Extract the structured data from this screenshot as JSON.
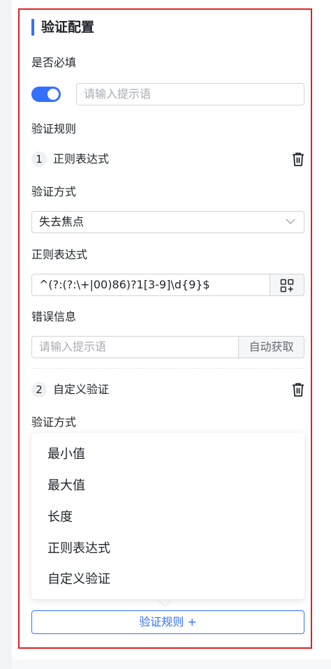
{
  "panel": {
    "title": "验证配置",
    "required_label": "是否必填",
    "required_toggle_on": true,
    "required_hint_placeholder": "请输入提示语",
    "rules_label": "验证规则",
    "rules": [
      {
        "index": "1",
        "name": "正则表达式",
        "method_label": "验证方式",
        "method_value": "失去焦点",
        "regex_label": "正则表达式",
        "regex_value": "^(?:(?:\\+|00)86)?1[3-9]\\d{9}$",
        "error_label": "错误信息",
        "error_placeholder": "请输入提示语",
        "auto_fetch_label": "自动获取"
      },
      {
        "index": "2",
        "name": "自定义验证",
        "method_label": "验证方式"
      }
    ],
    "method_options": [
      "最小值",
      "最大值",
      "长度",
      "正则表达式",
      "自定义验证"
    ],
    "add_rule_label": "验证规则 +"
  },
  "colors": {
    "accent": "#3370ff",
    "highlight_border": "#e02020"
  },
  "icons": {
    "delete": "trash-icon",
    "select": "chevron-down-icon",
    "regex_picker": "grid-plus-icon"
  }
}
